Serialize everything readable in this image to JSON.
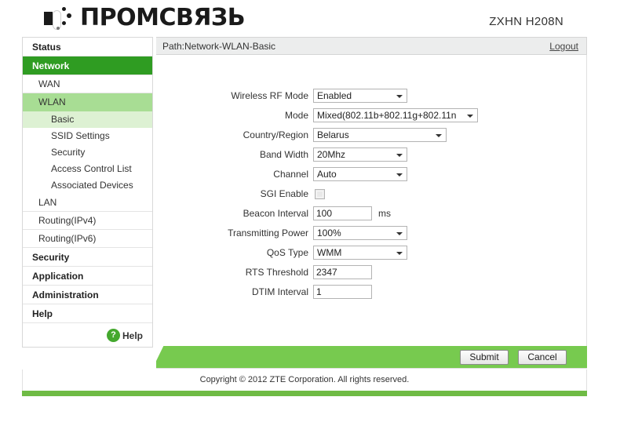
{
  "header": {
    "logo_text": "ПРОМСВЯЗЬ",
    "logo_icon": "promsvyaz-logo-icon",
    "model": "ZXHN H208N"
  },
  "sidebar": {
    "items": [
      {
        "label": "Status",
        "level": "top",
        "state": "normal"
      },
      {
        "label": "Network",
        "level": "top",
        "state": "active"
      },
      {
        "label": "WAN",
        "level": "2",
        "state": "normal"
      },
      {
        "label": "WLAN",
        "level": "2",
        "state": "active"
      },
      {
        "label": "Basic",
        "level": "3",
        "state": "selected"
      },
      {
        "label": "SSID Settings",
        "level": "3",
        "state": "normal"
      },
      {
        "label": "Security",
        "level": "3",
        "state": "normal"
      },
      {
        "label": "Access Control List",
        "level": "3",
        "state": "normal"
      },
      {
        "label": "Associated Devices",
        "level": "3",
        "state": "normal"
      },
      {
        "label": "LAN",
        "level": "2",
        "state": "normal"
      },
      {
        "label": "Routing(IPv4)",
        "level": "2",
        "state": "normal"
      },
      {
        "label": "Routing(IPv6)",
        "level": "2",
        "state": "normal"
      },
      {
        "label": "Security",
        "level": "top",
        "state": "normal"
      },
      {
        "label": "Application",
        "level": "top",
        "state": "normal"
      },
      {
        "label": "Administration",
        "level": "top",
        "state": "normal"
      },
      {
        "label": "Help",
        "level": "top",
        "state": "normal"
      }
    ],
    "help": {
      "icon": "question-mark-icon",
      "glyph": "?",
      "label": "Help"
    }
  },
  "main": {
    "path": "Path:Network-WLAN-Basic",
    "logout": "Logout",
    "form": {
      "wireless_rf_mode": {
        "label": "Wireless RF Mode",
        "value": "Enabled",
        "type": "select"
      },
      "mode": {
        "label": "Mode",
        "value": "Mixed(802.11b+802.11g+802.11n",
        "type": "select"
      },
      "country_region": {
        "label": "Country/Region",
        "value": "Belarus",
        "type": "select"
      },
      "band_width": {
        "label": "Band Width",
        "value": "20Mhz",
        "type": "select"
      },
      "channel": {
        "label": "Channel",
        "value": "Auto",
        "type": "select"
      },
      "sgi_enable": {
        "label": "SGI Enable",
        "value": "",
        "checked": false,
        "type": "checkbox"
      },
      "beacon_interval": {
        "label": "Beacon Interval",
        "value": "100",
        "unit": "ms",
        "type": "text"
      },
      "transmitting_power": {
        "label": "Transmitting Power",
        "value": "100%",
        "type": "select"
      },
      "qos_type": {
        "label": "QoS Type",
        "value": "WMM",
        "type": "select"
      },
      "rts_threshold": {
        "label": "RTS Threshold",
        "value": "2347",
        "type": "text"
      },
      "dtim_interval": {
        "label": "DTIM Interval",
        "value": "1",
        "type": "text"
      }
    },
    "buttons": {
      "submit": "Submit",
      "cancel": "Cancel"
    }
  },
  "footer": {
    "copyright": "Copyright © 2012 ZTE Corporation. All rights reserved."
  },
  "colors": {
    "accent_dark_green": "#2f9c22",
    "accent_green": "#77ca4f",
    "accent_strip": "#6fbb45",
    "nav_level2_active": "#a8dd94",
    "nav_level3_selected": "#ddf1d3",
    "pathbar_bg": "#eceded"
  }
}
